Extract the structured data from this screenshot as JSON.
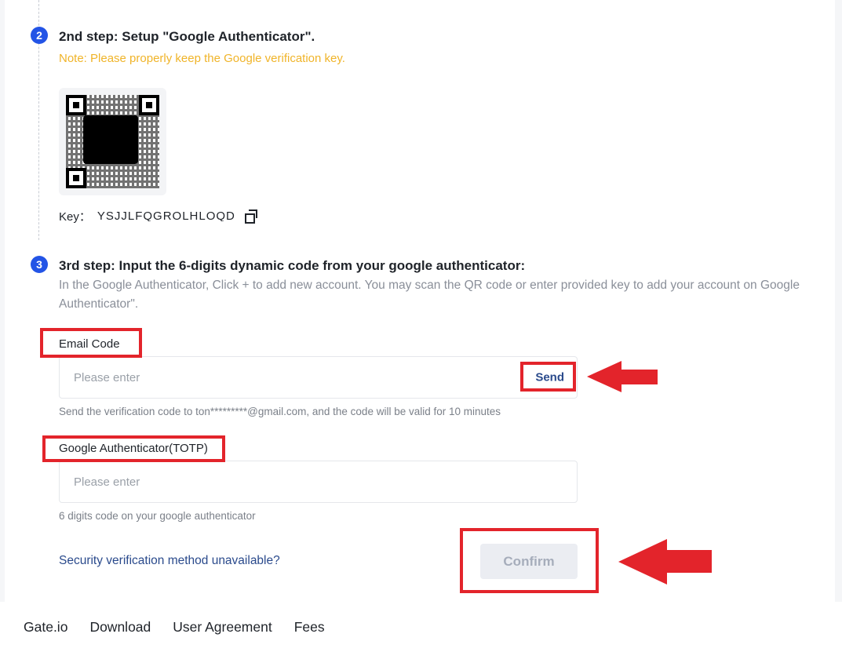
{
  "step2": {
    "number": "2",
    "title": "2nd step: Setup \"Google Authenticator\".",
    "note": "Note: Please properly keep the Google verification key.",
    "key_label": "Key：",
    "key_value": "YSJJLFQGROLHLOQD"
  },
  "step3": {
    "number": "3",
    "title": "3rd step: Input the 6-digits dynamic code from your google authenticator:",
    "description": "In the Google Authenticator, Click + to add new account. You may scan the QR code or enter provided key to add your account on Google Authenticator\"."
  },
  "email_code": {
    "label": "Email Code",
    "placeholder": "Please enter",
    "value": "",
    "send_label": "Send",
    "hint": "Send the verification code to ton*********@gmail.com, and the code will be valid for 10 minutes"
  },
  "totp": {
    "label": "Google Authenticator(TOTP)",
    "placeholder": "Please enter",
    "value": "",
    "hint": "6 digits code on your google authenticator"
  },
  "actions": {
    "unavailable_link": "Security verification method unavailable?",
    "confirm_label": "Confirm"
  },
  "footer": {
    "links": [
      "Gate.io",
      "Download",
      "User Agreement",
      "Fees"
    ]
  },
  "colors": {
    "accent": "#2354e6",
    "note": "#f0b429",
    "annotation_red": "#e3242b",
    "link": "#2a4a8c"
  },
  "icons": {
    "copy": "copy-icon",
    "qr": "qr-code",
    "arrow": "red-arrow-left"
  }
}
